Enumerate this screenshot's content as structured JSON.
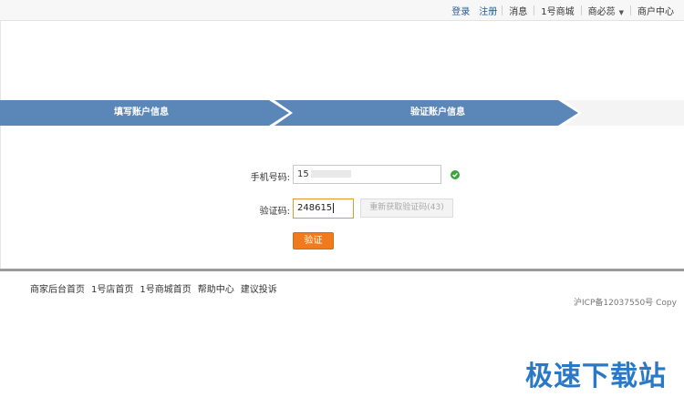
{
  "top_nav": {
    "login": "登录",
    "register": "注册",
    "messages": "消息",
    "store": "1号商城",
    "merchant_tool": "商必蕊",
    "merchant_center": "商户中心"
  },
  "steps": [
    {
      "label": "填写账户信息"
    },
    {
      "label": "验证账户信息"
    }
  ],
  "form": {
    "phone_label": "手机号码:",
    "phone_value": "15",
    "code_label": "验证码:",
    "code_value": "248615",
    "resend_label": "重新获取验证码(43)",
    "verify_label": "验证"
  },
  "footer": {
    "links": [
      "商家后台首页",
      "1号店首页",
      "1号商城首页",
      "帮助中心",
      "建议投诉"
    ],
    "icp": "沪ICP备12037550号",
    "copyright": "Copy"
  },
  "watermark": "极速下载站",
  "colors": {
    "step_active": "#5b87b8",
    "step_inactive": "#f4f4f4",
    "link": "#1e5c9e",
    "accent_orange": "#f07a1c",
    "success_green": "#3aa53a",
    "watermark": "#2a78c8"
  }
}
